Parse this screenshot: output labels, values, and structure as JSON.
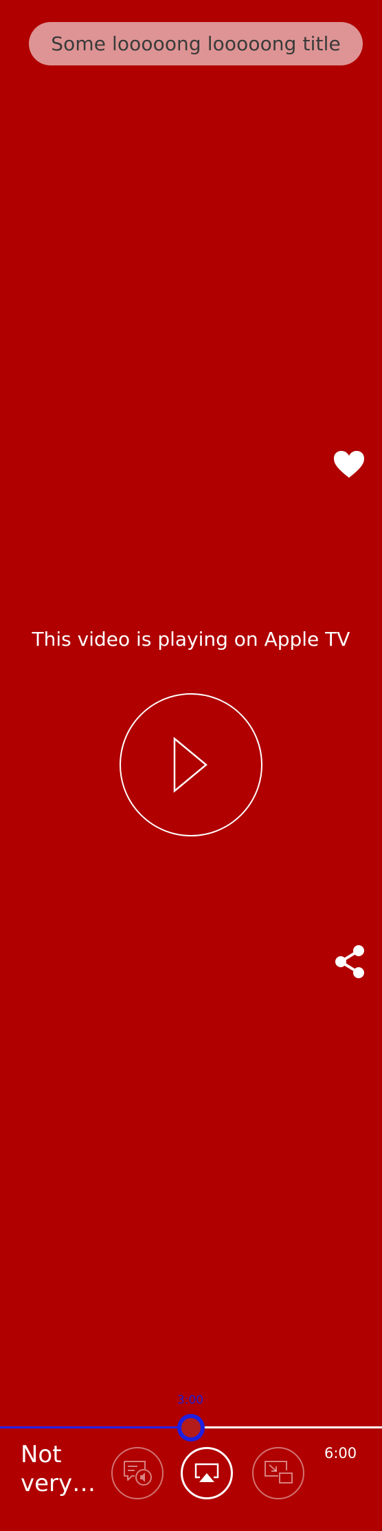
{
  "header": {
    "title": "Some looooong looooong title"
  },
  "main": {
    "status_message": "This video is playing on Apple TV"
  },
  "player": {
    "current_time": "3:00",
    "duration": "6:00",
    "progress_fraction": 0.5,
    "video_label": "Not very…"
  },
  "controls": [
    {
      "name": "audio-subtitles-icon",
      "state": "dim"
    },
    {
      "name": "airplay-icon",
      "state": "active"
    },
    {
      "name": "picture-in-picture-icon",
      "state": "dim"
    }
  ],
  "colors": {
    "background": "#b00000",
    "progress_accent": "#2222ee",
    "time_bubble_text": "#1d1dd6",
    "title_text": "#3a3a3a"
  }
}
